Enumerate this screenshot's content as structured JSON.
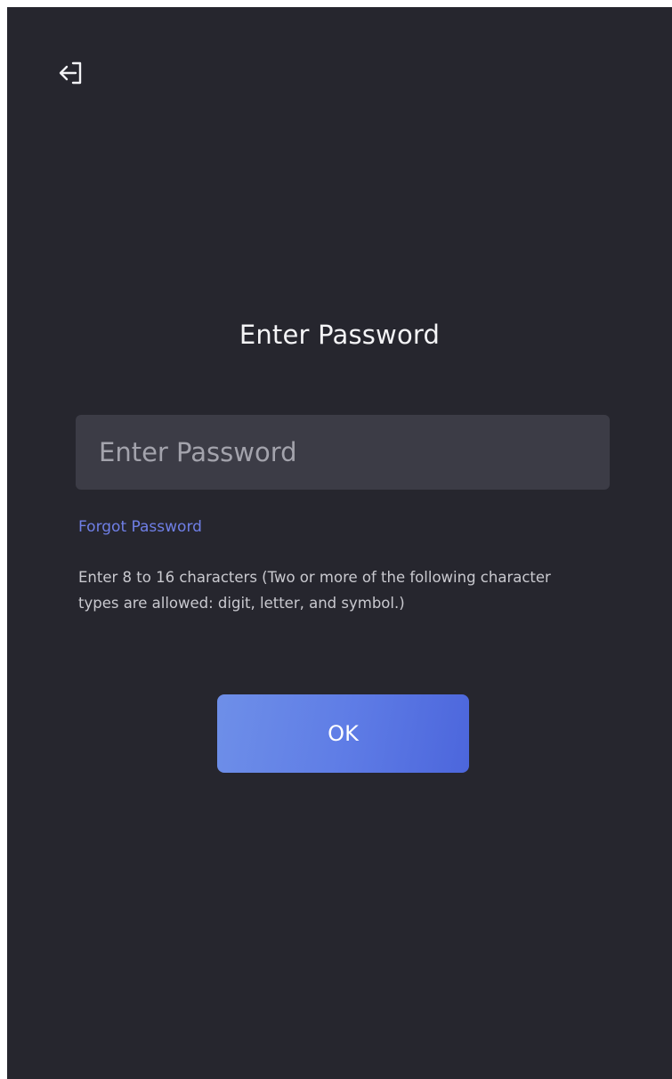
{
  "header": {
    "back_icon": "exit-arrow-icon"
  },
  "login": {
    "title": "Enter Password",
    "password_placeholder": "Enter Password",
    "password_value": "",
    "forgot_password": "Forgot Password",
    "hint": "Enter 8 to 16 characters (Two or more of the following character types are allowed: digit, letter, and symbol.)",
    "ok_label": "OK"
  },
  "colors": {
    "background": "#26262e",
    "field": "#3c3c46",
    "link": "#6f7fe6",
    "button_start": "#6e8fe8",
    "button_end": "#4c66dc"
  }
}
